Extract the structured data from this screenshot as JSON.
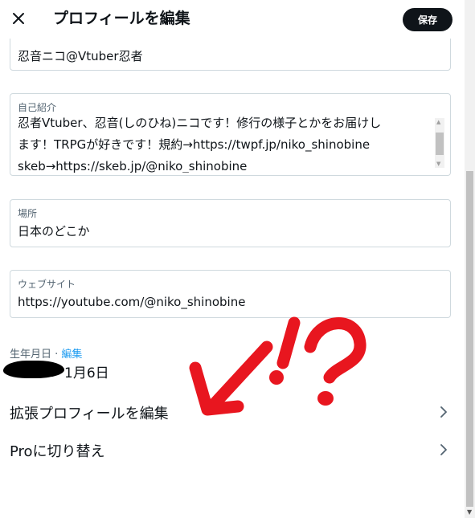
{
  "header": {
    "close_icon": "close-icon",
    "title": "プロフィールを編集",
    "save_label": "保存"
  },
  "fields": {
    "name": {
      "value": "忍音ニコ@Vtuber忍者"
    },
    "bio": {
      "label": "自己紹介",
      "lines": [
        "忍者Vtuber、忍音(しのひね)ニコです！修行の様子とかをお届けし",
        "ます！TRPGが好きです！規約→https://twpf.jp/niko_shinobine",
        "skeb→https://skeb.jp/@niko_shinobine"
      ]
    },
    "location": {
      "label": "場所",
      "value": "日本のどこか"
    },
    "website": {
      "label": "ウェブサイト",
      "value": "https://youtube.com/@niko_shinobine"
    }
  },
  "birthday": {
    "label": "生年月日",
    "separator": " · ",
    "edit_label": "編集",
    "value_visible": "1月6日"
  },
  "rows": {
    "extended_profile": "拡張プロフィールを編集",
    "switch_pro": "Proに切り替え"
  },
  "colors": {
    "accent": "#1d9bf0",
    "text": "#0f1419",
    "muted": "#536471",
    "border": "#cfd9de",
    "annotation": "#e8161f"
  }
}
